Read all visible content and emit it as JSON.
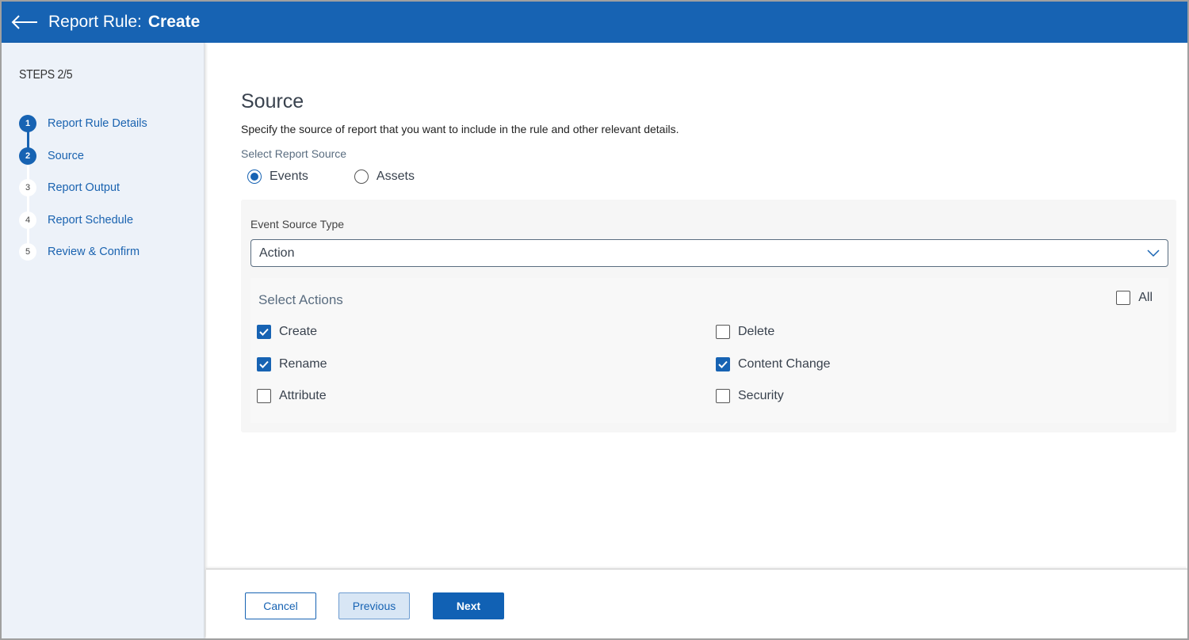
{
  "header": {
    "title_prefix": "Report Rule:",
    "title_action": "Create",
    "back_icon": "arrow-left-icon"
  },
  "sidebar": {
    "steps_title": "STEPS 2/5",
    "current_step": 2,
    "total_steps": 5,
    "steps": [
      {
        "number": "1",
        "label": "Report Rule Details",
        "state": "done"
      },
      {
        "number": "2",
        "label": "Source",
        "state": "active"
      },
      {
        "number": "3",
        "label": "Report Output",
        "state": "pending"
      },
      {
        "number": "4",
        "label": "Report Schedule",
        "state": "pending"
      },
      {
        "number": "5",
        "label": "Review & Confirm",
        "state": "pending"
      }
    ]
  },
  "main": {
    "title": "Source",
    "description": "Specify the source of report that you want to include in the rule and other relevant details.",
    "report_source": {
      "label": "Select Report Source",
      "options": [
        {
          "label": "Events",
          "selected": true
        },
        {
          "label": "Assets",
          "selected": false
        }
      ]
    },
    "event_source_type": {
      "label": "Event Source Type",
      "value": "Action",
      "icon": "chevron-down-icon"
    },
    "actions": {
      "title": "Select Actions",
      "all_label": "All",
      "all_checked": false,
      "items": [
        {
          "label": "Create",
          "checked": true
        },
        {
          "label": "Delete",
          "checked": false
        },
        {
          "label": "Rename",
          "checked": true
        },
        {
          "label": "Content Change",
          "checked": true
        },
        {
          "label": "Attribute",
          "checked": false
        },
        {
          "label": "Security",
          "checked": false
        }
      ]
    }
  },
  "footer": {
    "cancel_label": "Cancel",
    "previous_label": "Previous",
    "next_label": "Next"
  },
  "colors": {
    "brand": "#1763b3",
    "sidebar_bg": "#edf2f9",
    "panel_bg": "#f6f6f6"
  }
}
